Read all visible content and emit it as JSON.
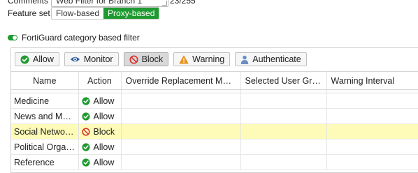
{
  "form": {
    "comments_label": "Comments",
    "comments_value": "Web Filter for Branch 1",
    "comments_counter": "23/255",
    "feature_set_label": "Feature set",
    "feature_set_options": [
      "Flow-based",
      "Proxy-based"
    ],
    "feature_set_selected": "Proxy-based"
  },
  "fortiguard": {
    "toggle_label": "FortiGuard category based filter",
    "toggle_on": true
  },
  "toolbar": {
    "allow": "Allow",
    "monitor": "Monitor",
    "block": "Block",
    "warning": "Warning",
    "authenticate": "Authenticate"
  },
  "table": {
    "headers": [
      "Name",
      "Action",
      "Override Replacement Message",
      "Selected User Groups",
      "Warning Interval"
    ],
    "rows": [
      {
        "name": "Medicine",
        "action": "Allow"
      },
      {
        "name": "News and Media",
        "action": "Allow"
      },
      {
        "name": "Social Networking",
        "action": "Block",
        "selected": true
      },
      {
        "name": "Political Organiz…",
        "action": "Allow"
      },
      {
        "name": "Reference",
        "action": "Allow"
      }
    ]
  },
  "colors": {
    "accent_green": "#1f9a30",
    "block_red": "#d9302c",
    "warning_orange": "#e8931b",
    "monitor_blue": "#2e5f9e",
    "selected_row": "#fdfbb7"
  }
}
